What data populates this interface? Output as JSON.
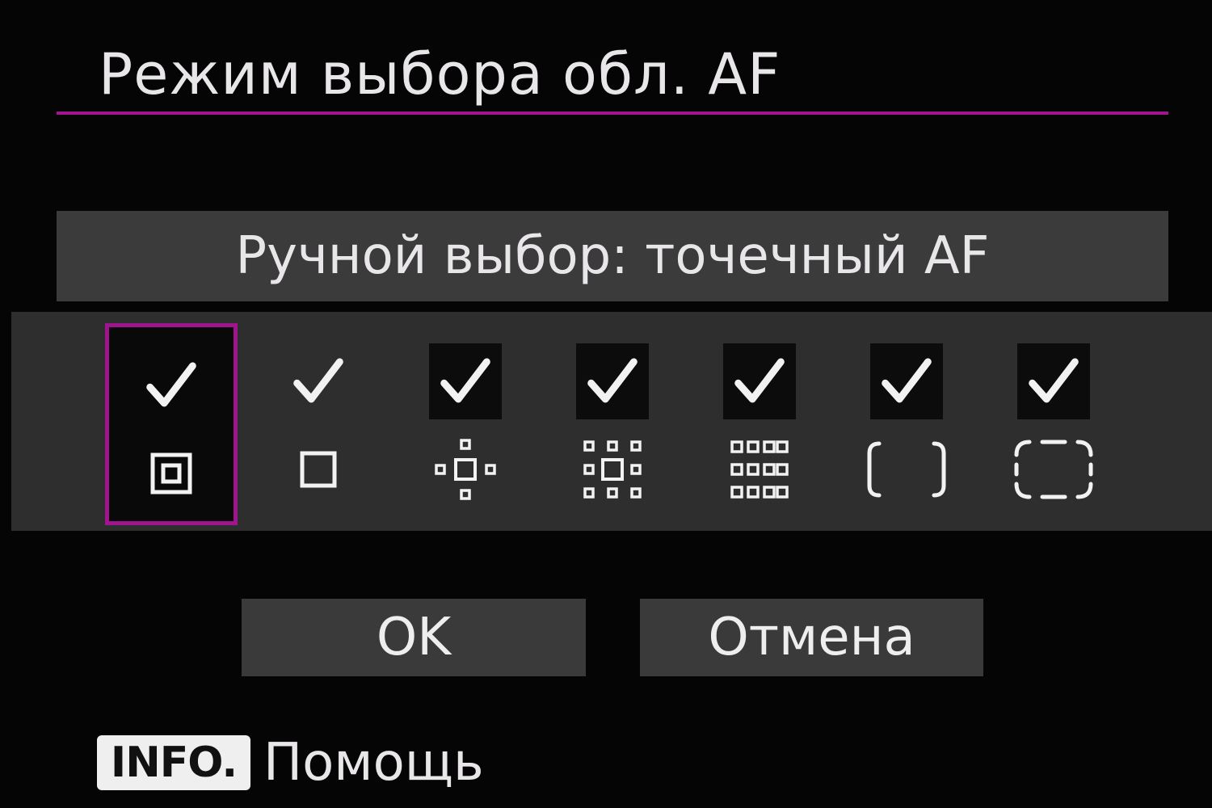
{
  "screen": {
    "title": "Режим выбора обл. AF",
    "accent_color": "#a0158e"
  },
  "current_mode": {
    "label": "Ручной выбор: точечный AF"
  },
  "af_modes": [
    {
      "icon": "spot-af-icon",
      "checked": true,
      "selected": true
    },
    {
      "icon": "single-point-af-icon",
      "checked": true,
      "selected": false
    },
    {
      "icon": "expand-af-area-cross-icon",
      "checked": true,
      "selected": false
    },
    {
      "icon": "expand-af-area-surround-icon",
      "checked": true,
      "selected": false
    },
    {
      "icon": "zone-af-icon",
      "checked": true,
      "selected": false
    },
    {
      "icon": "large-zone-af-icon",
      "checked": true,
      "selected": false
    },
    {
      "icon": "auto-af-point-selection-icon",
      "checked": true,
      "selected": false
    }
  ],
  "buttons": {
    "ok_label": "OK",
    "cancel_label": "Отмена"
  },
  "footer": {
    "info_key": "INFO.",
    "help_label": "Помощь"
  }
}
